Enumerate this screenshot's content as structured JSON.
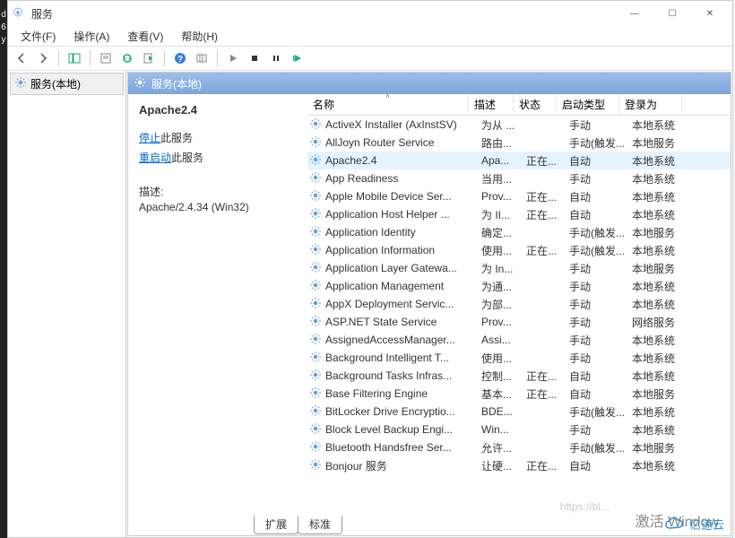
{
  "window": {
    "title": "服务",
    "controls": {
      "min": "—",
      "max": "☐",
      "close": "✕"
    }
  },
  "menubar": {
    "items": [
      "文件(F)",
      "操作(A)",
      "查看(V)",
      "帮助(H)"
    ]
  },
  "tree": {
    "root": "服务(本地)"
  },
  "pane_header": "服务(本地)",
  "detail": {
    "name": "Apache2.4",
    "stop_link": "停止",
    "stop_suffix": "此服务",
    "restart_link": "重启动",
    "restart_suffix": "此服务",
    "desc_label": "描述:",
    "desc_value": "Apache/2.4.34 (Win32)"
  },
  "columns": {
    "name": "名称",
    "desc": "描述",
    "status": "状态",
    "start": "启动类型",
    "logon": "登录为",
    "sort_ind": "˄"
  },
  "services": [
    {
      "name": "ActiveX Installer (AxInstSV)",
      "desc": "为从 ...",
      "status": "",
      "start": "手动",
      "logon": "本地系统"
    },
    {
      "name": "AllJoyn Router Service",
      "desc": "路由...",
      "status": "",
      "start": "手动(触发...",
      "logon": "本地服务"
    },
    {
      "name": "Apache2.4",
      "desc": "Apa...",
      "status": "正在...",
      "start": "自动",
      "logon": "本地系统",
      "selected": true
    },
    {
      "name": "App Readiness",
      "desc": "当用...",
      "status": "",
      "start": "手动",
      "logon": "本地系统"
    },
    {
      "name": "Apple Mobile Device Ser...",
      "desc": "Prov...",
      "status": "正在...",
      "start": "自动",
      "logon": "本地系统"
    },
    {
      "name": "Application Host Helper ...",
      "desc": "为 II...",
      "status": "正在...",
      "start": "自动",
      "logon": "本地系统"
    },
    {
      "name": "Application Identity",
      "desc": "确定...",
      "status": "",
      "start": "手动(触发...",
      "logon": "本地服务"
    },
    {
      "name": "Application Information",
      "desc": "使用...",
      "status": "正在...",
      "start": "手动(触发...",
      "logon": "本地系统"
    },
    {
      "name": "Application Layer Gatewa...",
      "desc": "为 In...",
      "status": "",
      "start": "手动",
      "logon": "本地服务"
    },
    {
      "name": "Application Management",
      "desc": "为通...",
      "status": "",
      "start": "手动",
      "logon": "本地系统"
    },
    {
      "name": "AppX Deployment Servic...",
      "desc": "为部...",
      "status": "",
      "start": "手动",
      "logon": "本地系统"
    },
    {
      "name": "ASP.NET State Service",
      "desc": "Prov...",
      "status": "",
      "start": "手动",
      "logon": "网络服务"
    },
    {
      "name": "AssignedAccessManager...",
      "desc": "Assi...",
      "status": "",
      "start": "手动",
      "logon": "本地系统"
    },
    {
      "name": "Background Intelligent T...",
      "desc": "使用...",
      "status": "",
      "start": "手动",
      "logon": "本地系统"
    },
    {
      "name": "Background Tasks Infras...",
      "desc": "控制...",
      "status": "正在...",
      "start": "自动",
      "logon": "本地系统"
    },
    {
      "name": "Base Filtering Engine",
      "desc": "基本...",
      "status": "正在...",
      "start": "自动",
      "logon": "本地服务"
    },
    {
      "name": "BitLocker Drive Encryptio...",
      "desc": "BDE...",
      "status": "",
      "start": "手动(触发...",
      "logon": "本地系统"
    },
    {
      "name": "Block Level Backup Engi...",
      "desc": "Win...",
      "status": "",
      "start": "手动",
      "logon": "本地系统"
    },
    {
      "name": "Bluetooth Handsfree Ser...",
      "desc": "允许...",
      "status": "",
      "start": "手动(触发...",
      "logon": "本地服务"
    },
    {
      "name": "Bonjour 服务",
      "desc": "让硬...",
      "status": "正在...",
      "start": "自动",
      "logon": "本地系统"
    }
  ],
  "tabs": {
    "extended": "扩展",
    "standard": "标准"
  },
  "watermark": {
    "text": "激活 Window",
    "url": "https://bl...",
    "cloud": "亿速云"
  },
  "left_edge": "d\n6\ny"
}
